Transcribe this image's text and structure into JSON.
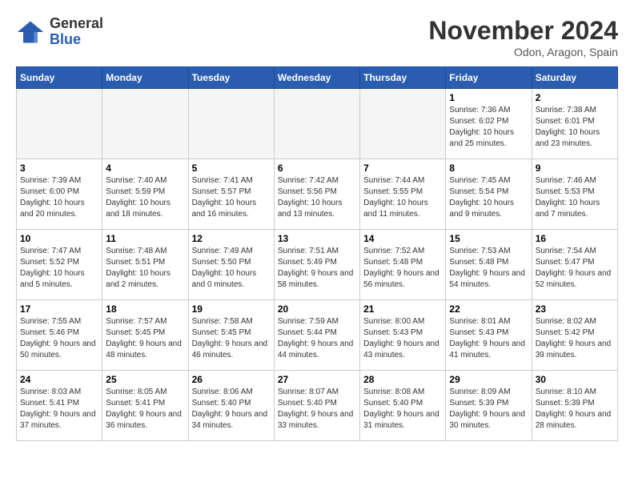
{
  "header": {
    "logo_general": "General",
    "logo_blue": "Blue",
    "month_title": "November 2024",
    "location": "Odon, Aragon, Spain"
  },
  "weekdays": [
    "Sunday",
    "Monday",
    "Tuesday",
    "Wednesday",
    "Thursday",
    "Friday",
    "Saturday"
  ],
  "weeks": [
    [
      {
        "day": "",
        "info": ""
      },
      {
        "day": "",
        "info": ""
      },
      {
        "day": "",
        "info": ""
      },
      {
        "day": "",
        "info": ""
      },
      {
        "day": "",
        "info": ""
      },
      {
        "day": "1",
        "info": "Sunrise: 7:36 AM\nSunset: 6:02 PM\nDaylight: 10 hours and 25 minutes."
      },
      {
        "day": "2",
        "info": "Sunrise: 7:38 AM\nSunset: 6:01 PM\nDaylight: 10 hours and 23 minutes."
      }
    ],
    [
      {
        "day": "3",
        "info": "Sunrise: 7:39 AM\nSunset: 6:00 PM\nDaylight: 10 hours and 20 minutes."
      },
      {
        "day": "4",
        "info": "Sunrise: 7:40 AM\nSunset: 5:59 PM\nDaylight: 10 hours and 18 minutes."
      },
      {
        "day": "5",
        "info": "Sunrise: 7:41 AM\nSunset: 5:57 PM\nDaylight: 10 hours and 16 minutes."
      },
      {
        "day": "6",
        "info": "Sunrise: 7:42 AM\nSunset: 5:56 PM\nDaylight: 10 hours and 13 minutes."
      },
      {
        "day": "7",
        "info": "Sunrise: 7:44 AM\nSunset: 5:55 PM\nDaylight: 10 hours and 11 minutes."
      },
      {
        "day": "8",
        "info": "Sunrise: 7:45 AM\nSunset: 5:54 PM\nDaylight: 10 hours and 9 minutes."
      },
      {
        "day": "9",
        "info": "Sunrise: 7:46 AM\nSunset: 5:53 PM\nDaylight: 10 hours and 7 minutes."
      }
    ],
    [
      {
        "day": "10",
        "info": "Sunrise: 7:47 AM\nSunset: 5:52 PM\nDaylight: 10 hours and 5 minutes."
      },
      {
        "day": "11",
        "info": "Sunrise: 7:48 AM\nSunset: 5:51 PM\nDaylight: 10 hours and 2 minutes."
      },
      {
        "day": "12",
        "info": "Sunrise: 7:49 AM\nSunset: 5:50 PM\nDaylight: 10 hours and 0 minutes."
      },
      {
        "day": "13",
        "info": "Sunrise: 7:51 AM\nSunset: 5:49 PM\nDaylight: 9 hours and 58 minutes."
      },
      {
        "day": "14",
        "info": "Sunrise: 7:52 AM\nSunset: 5:48 PM\nDaylight: 9 hours and 56 minutes."
      },
      {
        "day": "15",
        "info": "Sunrise: 7:53 AM\nSunset: 5:48 PM\nDaylight: 9 hours and 54 minutes."
      },
      {
        "day": "16",
        "info": "Sunrise: 7:54 AM\nSunset: 5:47 PM\nDaylight: 9 hours and 52 minutes."
      }
    ],
    [
      {
        "day": "17",
        "info": "Sunrise: 7:55 AM\nSunset: 5:46 PM\nDaylight: 9 hours and 50 minutes."
      },
      {
        "day": "18",
        "info": "Sunrise: 7:57 AM\nSunset: 5:45 PM\nDaylight: 9 hours and 48 minutes."
      },
      {
        "day": "19",
        "info": "Sunrise: 7:58 AM\nSunset: 5:45 PM\nDaylight: 9 hours and 46 minutes."
      },
      {
        "day": "20",
        "info": "Sunrise: 7:59 AM\nSunset: 5:44 PM\nDaylight: 9 hours and 44 minutes."
      },
      {
        "day": "21",
        "info": "Sunrise: 8:00 AM\nSunset: 5:43 PM\nDaylight: 9 hours and 43 minutes."
      },
      {
        "day": "22",
        "info": "Sunrise: 8:01 AM\nSunset: 5:43 PM\nDaylight: 9 hours and 41 minutes."
      },
      {
        "day": "23",
        "info": "Sunrise: 8:02 AM\nSunset: 5:42 PM\nDaylight: 9 hours and 39 minutes."
      }
    ],
    [
      {
        "day": "24",
        "info": "Sunrise: 8:03 AM\nSunset: 5:41 PM\nDaylight: 9 hours and 37 minutes."
      },
      {
        "day": "25",
        "info": "Sunrise: 8:05 AM\nSunset: 5:41 PM\nDaylight: 9 hours and 36 minutes."
      },
      {
        "day": "26",
        "info": "Sunrise: 8:06 AM\nSunset: 5:40 PM\nDaylight: 9 hours and 34 minutes."
      },
      {
        "day": "27",
        "info": "Sunrise: 8:07 AM\nSunset: 5:40 PM\nDaylight: 9 hours and 33 minutes."
      },
      {
        "day": "28",
        "info": "Sunrise: 8:08 AM\nSunset: 5:40 PM\nDaylight: 9 hours and 31 minutes."
      },
      {
        "day": "29",
        "info": "Sunrise: 8:09 AM\nSunset: 5:39 PM\nDaylight: 9 hours and 30 minutes."
      },
      {
        "day": "30",
        "info": "Sunrise: 8:10 AM\nSunset: 5:39 PM\nDaylight: 9 hours and 28 minutes."
      }
    ]
  ]
}
